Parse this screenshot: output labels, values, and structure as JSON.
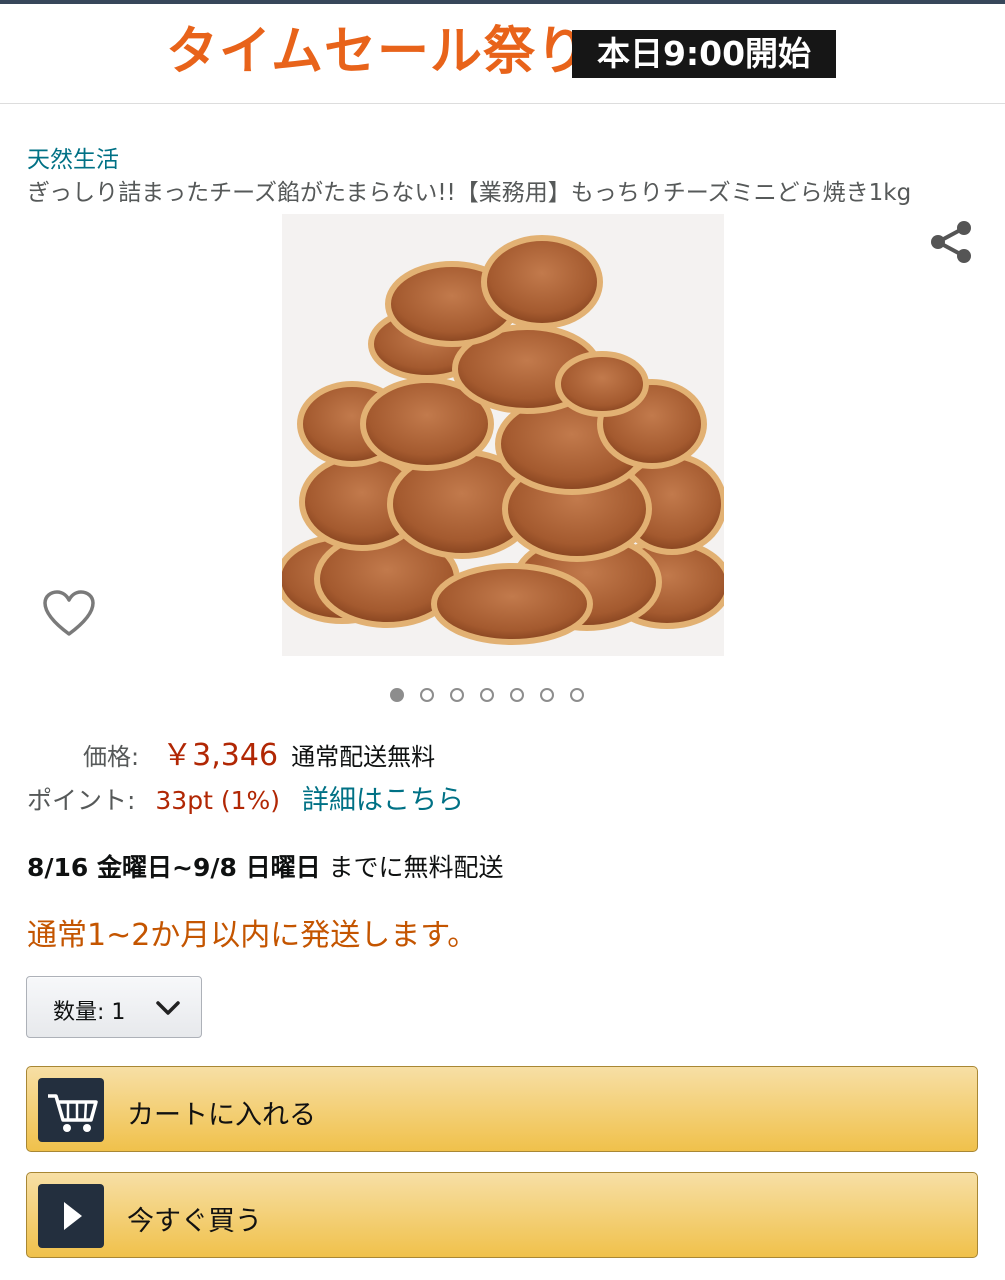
{
  "banner": {
    "title": "タイムセール祭り",
    "badge": "本日9:00開始",
    "title_color": "#e8631a"
  },
  "product": {
    "brand": "天然生活",
    "title": "ぎっしり詰まったチーズ餡がたまらない!!【業務用】もっちりチーズミニどら焼き1kg",
    "image_icon": "dorayaki-pile-image",
    "carousel_count": 7,
    "carousel_active": 1
  },
  "icons": {
    "share": "share-icon",
    "wishlist": "heart-icon"
  },
  "price": {
    "label": "価格:",
    "value": "￥3,346",
    "shipping": "通常配送無料",
    "color": "#b12704"
  },
  "points": {
    "label": "ポイント:",
    "value": "33pt (1%)",
    "link": "詳細はこちら"
  },
  "delivery": {
    "dates": "8/16 金曜日~9/8 日曜日",
    "suffix": "までに無料配送"
  },
  "availability": "通常1~2か月以内に発送します。",
  "quantity": {
    "label": "数量: 1"
  },
  "buttons": {
    "add_to_cart": "カートに入れる",
    "buy_now": "今すぐ買う",
    "cart_icon": "cart-icon",
    "buy_icon": "play-icon",
    "color": "#f0c14b"
  }
}
